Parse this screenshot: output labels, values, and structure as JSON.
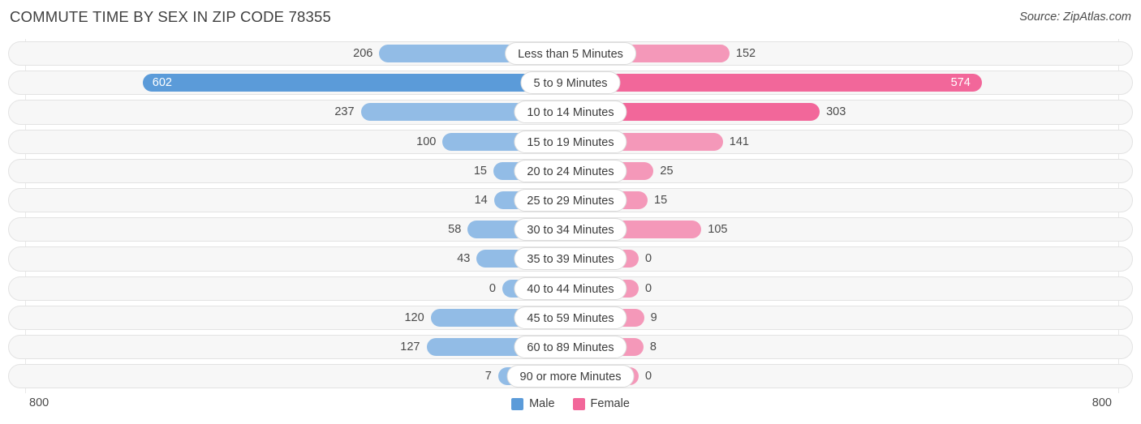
{
  "header": {
    "title": "COMMUTE TIME BY SEX IN ZIP CODE 78355",
    "source": "Source: ZipAtlas.com"
  },
  "axis": {
    "left_label": "800",
    "right_label": "800",
    "max": 800
  },
  "legend": {
    "items": [
      {
        "label": "Male",
        "color": "#5b9bd9"
      },
      {
        "label": "Female",
        "color": "#f2679a"
      }
    ]
  },
  "colors": {
    "male_light": "#92bce6",
    "male_strong": "#5b9bd9",
    "female_light": "#f498b9",
    "female_strong": "#f2679a",
    "track": "#f7f7f7",
    "gridline": "#e8e8e8"
  },
  "chart_data": {
    "type": "bar",
    "title": "COMMUTE TIME BY SEX IN ZIP CODE 78355",
    "subtitle": "Source: ZipAtlas.com",
    "orientation": "horizontal-diverging",
    "xlabel": "",
    "ylabel": "",
    "xlim": [
      800,
      800
    ],
    "grid": true,
    "legend_position": "bottom-center",
    "categories": [
      "Less than 5 Minutes",
      "5 to 9 Minutes",
      "10 to 14 Minutes",
      "15 to 19 Minutes",
      "20 to 24 Minutes",
      "25 to 29 Minutes",
      "30 to 34 Minutes",
      "35 to 39 Minutes",
      "40 to 44 Minutes",
      "45 to 59 Minutes",
      "60 to 89 Minutes",
      "90 or more Minutes"
    ],
    "series": [
      {
        "name": "Male",
        "side": "left",
        "values": [
          206,
          602,
          237,
          100,
          15,
          14,
          58,
          43,
          0,
          120,
          127,
          7
        ]
      },
      {
        "name": "Female",
        "side": "right",
        "values": [
          152,
          574,
          303,
          141,
          25,
          15,
          105,
          0,
          0,
          9,
          8,
          0
        ]
      }
    ]
  },
  "rows": [
    {
      "category": "Less than 5 Minutes",
      "male": "206",
      "female": "152",
      "male_value": 206,
      "female_value": 152,
      "male_inside": false,
      "female_inside": false,
      "male_strong": false,
      "female_strong": false
    },
    {
      "category": "5 to 9 Minutes",
      "male": "602",
      "female": "574",
      "male_value": 602,
      "female_value": 574,
      "male_inside": true,
      "female_inside": true,
      "male_strong": true,
      "female_strong": true
    },
    {
      "category": "10 to 14 Minutes",
      "male": "237",
      "female": "303",
      "male_value": 237,
      "female_value": 303,
      "male_inside": false,
      "female_inside": false,
      "male_strong": false,
      "female_strong": true
    },
    {
      "category": "15 to 19 Minutes",
      "male": "100",
      "female": "141",
      "male_value": 100,
      "female_value": 141,
      "male_inside": false,
      "female_inside": false,
      "male_strong": false,
      "female_strong": false
    },
    {
      "category": "20 to 24 Minutes",
      "male": "15",
      "female": "25",
      "male_value": 15,
      "female_value": 25,
      "male_inside": false,
      "female_inside": false,
      "male_strong": false,
      "female_strong": false
    },
    {
      "category": "25 to 29 Minutes",
      "male": "14",
      "female": "15",
      "male_value": 14,
      "female_value": 15,
      "male_inside": false,
      "female_inside": false,
      "male_strong": false,
      "female_strong": false
    },
    {
      "category": "30 to 34 Minutes",
      "male": "58",
      "female": "105",
      "male_value": 58,
      "female_value": 105,
      "male_inside": false,
      "female_inside": false,
      "male_strong": false,
      "female_strong": false
    },
    {
      "category": "35 to 39 Minutes",
      "male": "43",
      "female": "0",
      "male_value": 43,
      "female_value": 0,
      "male_inside": false,
      "female_inside": false,
      "male_strong": false,
      "female_strong": false
    },
    {
      "category": "40 to 44 Minutes",
      "male": "0",
      "female": "0",
      "male_value": 0,
      "female_value": 0,
      "male_inside": false,
      "female_inside": false,
      "male_strong": false,
      "female_strong": false
    },
    {
      "category": "45 to 59 Minutes",
      "male": "120",
      "female": "9",
      "male_value": 120,
      "female_value": 9,
      "male_inside": false,
      "female_inside": false,
      "male_strong": false,
      "female_strong": false
    },
    {
      "category": "60 to 89 Minutes",
      "male": "127",
      "female": "8",
      "male_value": 127,
      "female_value": 8,
      "male_inside": false,
      "female_inside": false,
      "male_strong": false,
      "female_strong": false
    },
    {
      "category": "90 or more Minutes",
      "male": "7",
      "female": "0",
      "male_value": 7,
      "female_value": 0,
      "male_inside": false,
      "female_inside": false,
      "male_strong": false,
      "female_strong": false
    }
  ]
}
